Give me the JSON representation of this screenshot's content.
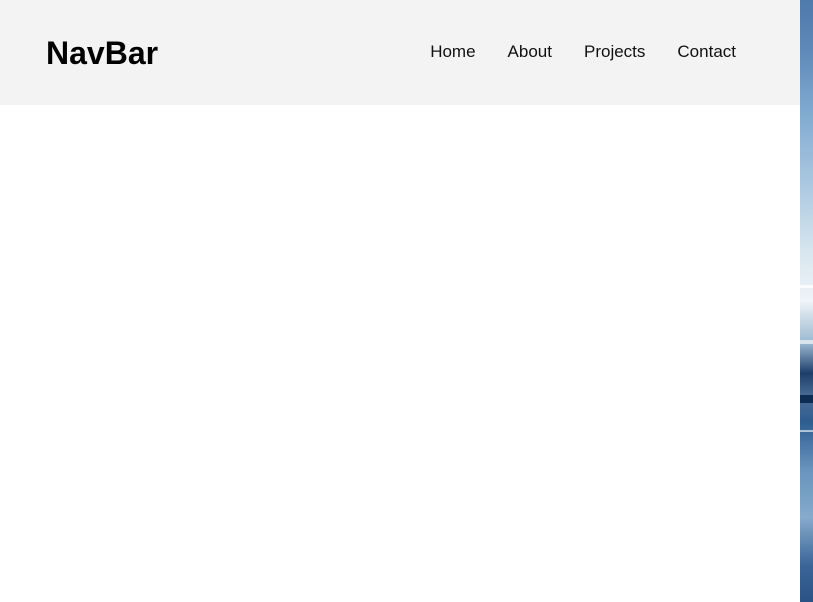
{
  "navbar": {
    "brand": "NavBar",
    "links": [
      "Home",
      "About",
      "Projects",
      "Contact"
    ]
  },
  "colors": {
    "navbar_background": "#f3f3f3",
    "page_background": "#ffffff",
    "brand_text": "#000000",
    "link_text": "#111111"
  },
  "background_image": {
    "description_icon": "ocean-photo-background"
  }
}
